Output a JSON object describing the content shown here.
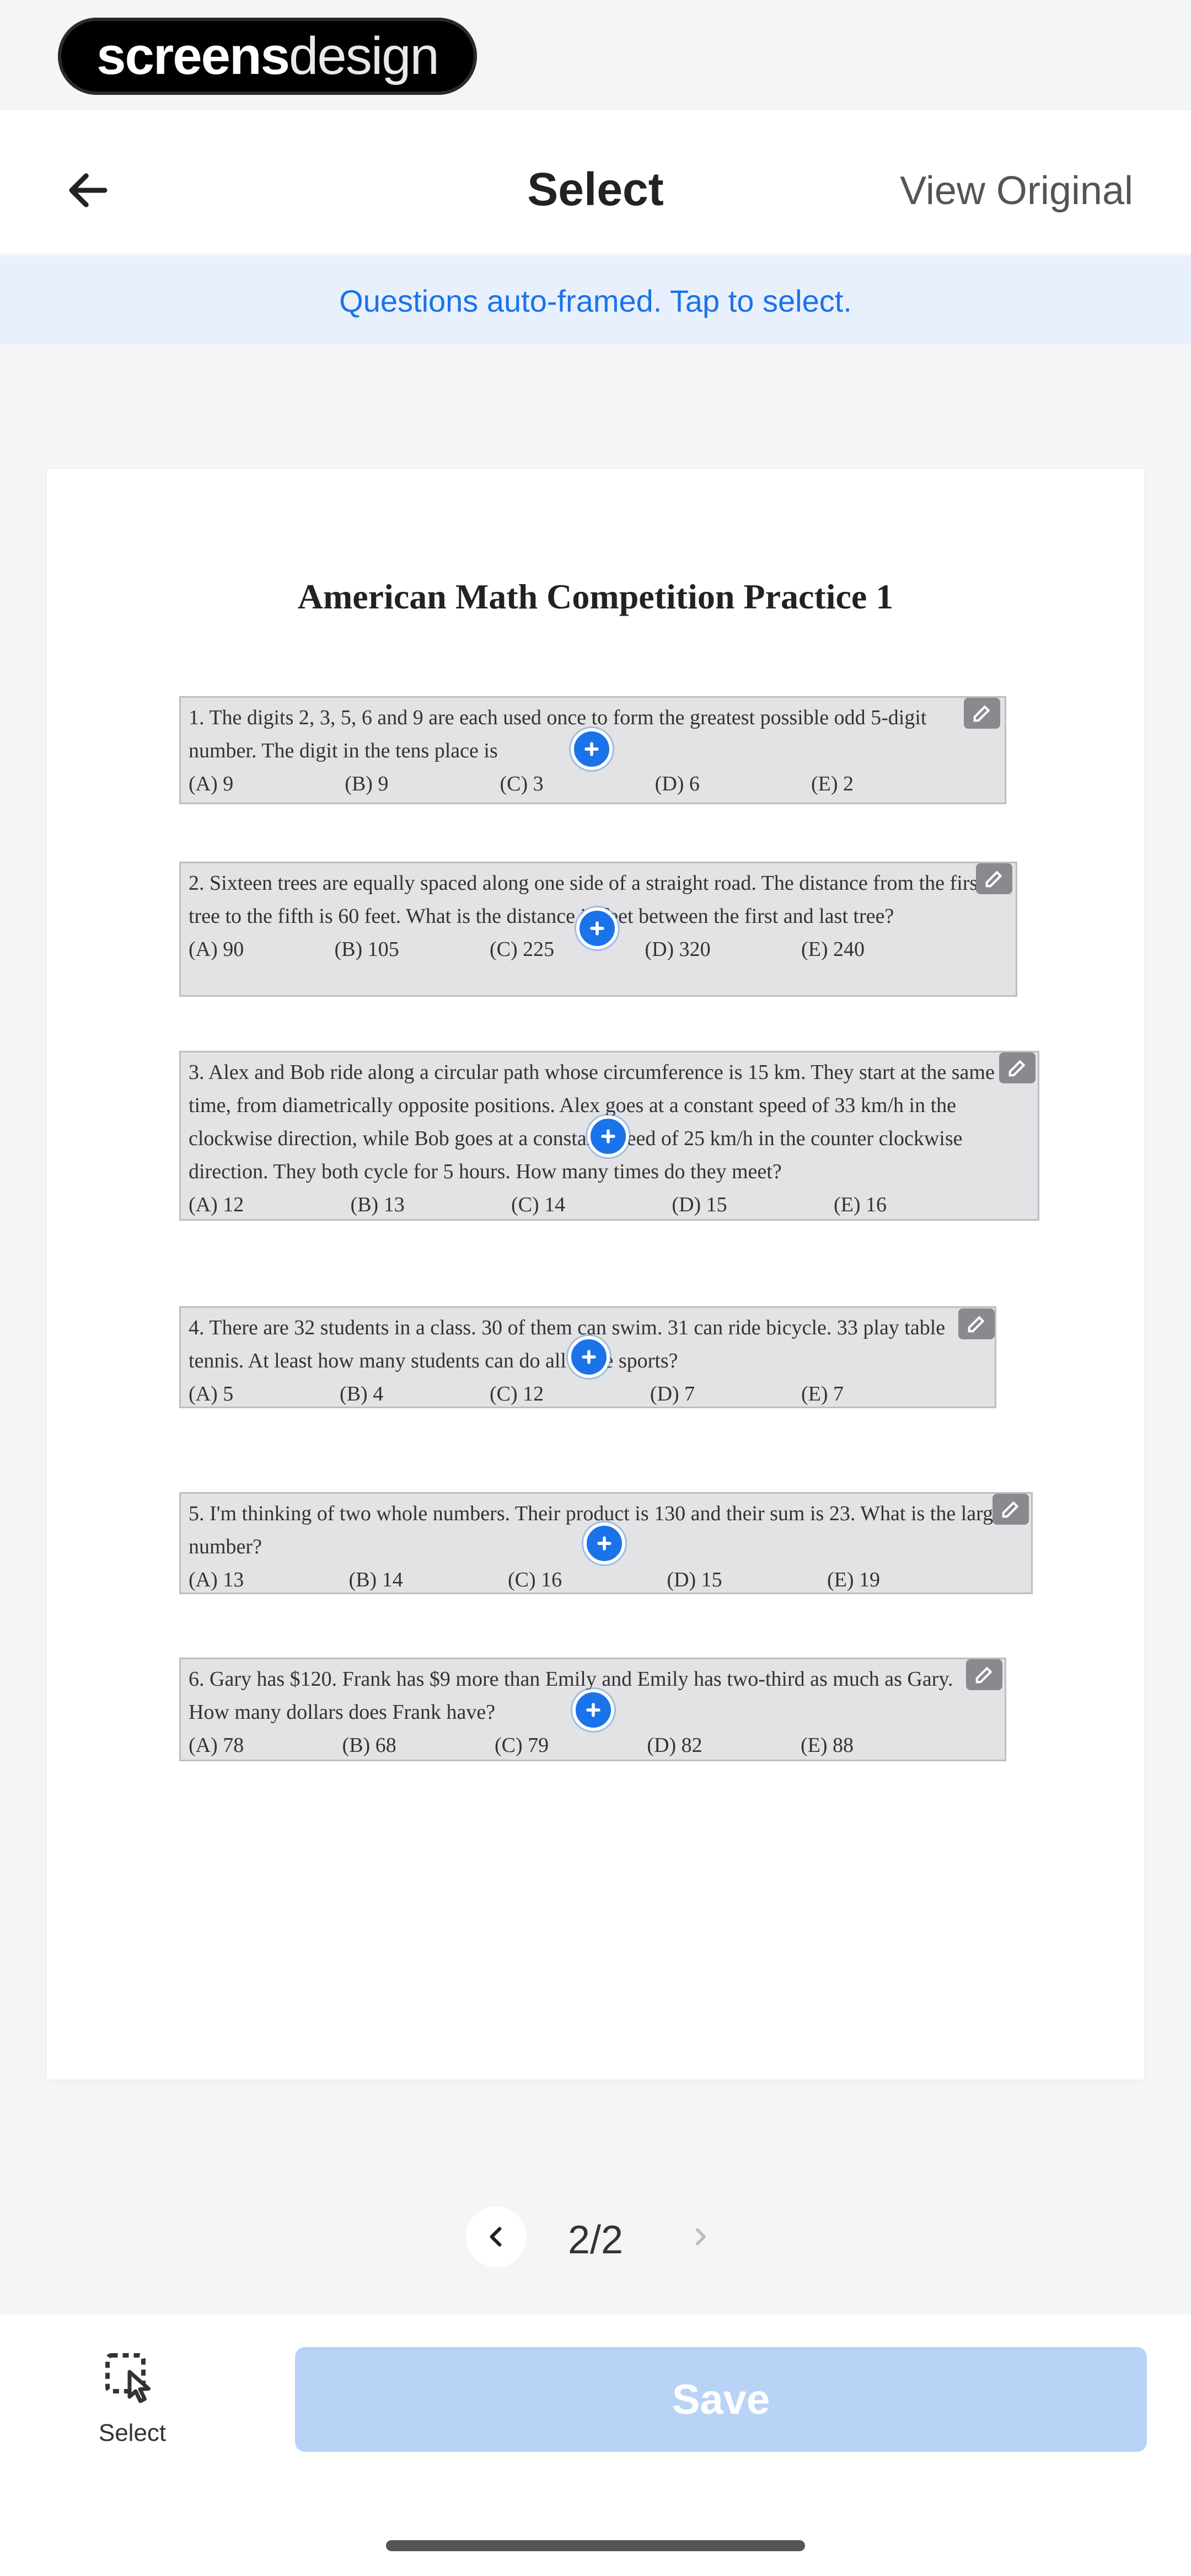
{
  "watermark": {
    "part1": "screens",
    "part2": "design"
  },
  "header": {
    "title": "Select",
    "view_original": "View Original"
  },
  "banner": {
    "text": "Questions auto-framed. Tap to select."
  },
  "document": {
    "title": "American Math Competition Practice 1",
    "questions": [
      {
        "text": "1. The digits 2, 3, 5, 6 and 9 are each used once to form the greatest possible odd 5-digit number. The digit in the tens place is",
        "options": [
          "(A) 9",
          "(B) 9",
          "(C) 3",
          "(D) 6",
          "(E) 2"
        ]
      },
      {
        "text": "2. Sixteen trees are equally spaced along one side of a straight road. The distance from the first tree to the fifth is 60 feet. What is the distance in feet between the first and last tree?",
        "options": [
          "(A) 90",
          "(B) 105",
          "(C) 225",
          "(D) 320",
          "(E) 240"
        ]
      },
      {
        "text": "3. Alex and Bob ride along a circular path whose circumference is 15 km. They start at the same time, from diametrically opposite positions. Alex goes at a constant speed of 33 km/h in the clockwise direction, while Bob goes at a constant speed of 25 km/h in the counter clockwise direction. They both cycle for 5 hours. How many times do they meet?",
        "options": [
          "(A) 12",
          "(B) 13",
          "(C) 14",
          "(D) 15",
          "(E) 16"
        ]
      },
      {
        "text": "4. There are 32 students in a class. 30 of them can swim. 31 can ride bicycle. 33 play table tennis. At least how many students can do all three sports?",
        "options": [
          "(A) 5",
          "(B) 4",
          "(C) 12",
          "(D) 7",
          "(E) 7"
        ]
      },
      {
        "text": "5. I'm thinking of two whole numbers. Their product is 130 and their sum is 23. What is the larger number?",
        "options": [
          "(A) 13",
          "(B) 14",
          "(C) 16",
          "(D) 15",
          "(E) 19"
        ]
      },
      {
        "text": "6. Gary has $120. Frank has $9 more than Emily and Emily has two-third as much as Gary. How many dollars does Frank have?",
        "options": [
          "(A) 78",
          "(B) 68",
          "(C) 79",
          "(D) 82",
          "(E) 88"
        ]
      }
    ]
  },
  "pagination": {
    "label": "2/2"
  },
  "toolbar": {
    "select_label": "Select",
    "save_label": "Save"
  },
  "colors": {
    "accent": "#1a73e8",
    "save_disabled": "#b9d3f6",
    "banner_bg": "#e8f0fe",
    "question_bg": "#e3e3e5"
  },
  "icons": {
    "back": "arrow-left-icon",
    "edit": "edit-icon",
    "add": "plus-icon",
    "prev": "chevron-left-icon",
    "next": "chevron-right-icon",
    "select": "select-pointer-icon"
  }
}
